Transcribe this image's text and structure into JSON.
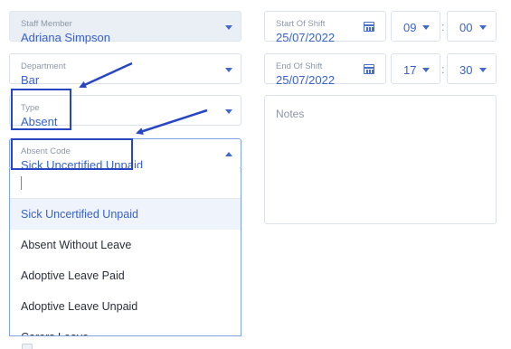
{
  "staff_member": {
    "label": "Staff Member",
    "value": "Adriana Simpson"
  },
  "department": {
    "label": "Department",
    "value": "Bar"
  },
  "type": {
    "label": "Type",
    "value": "Absent"
  },
  "absent_code": {
    "label": "Absent Code",
    "value": "Sick Uncertified Unpaid",
    "search_value": "",
    "options": [
      "Sick Uncertified Unpaid",
      "Absent Without Leave",
      "Adoptive Leave Paid",
      "Adoptive Leave Unpaid",
      "Carers Leave"
    ],
    "selected_index": 0
  },
  "start_of_shift": {
    "label": "Start Of Shift",
    "date": "25/07/2022",
    "hour": "09",
    "minute": "00"
  },
  "end_of_shift": {
    "label": "End Of Shift",
    "date": "25/07/2022",
    "hour": "17",
    "minute": "30"
  },
  "time_separator": ":",
  "notes": {
    "placeholder": "Notes"
  },
  "colors": {
    "accent": "#3a63c6",
    "highlight": "#2747c2",
    "field_filled": "#eaeef5",
    "selected_option": "#eef3fc"
  },
  "icons": [
    "calendar-icon",
    "chevron-down-icon",
    "chevron-up-icon",
    "annotation-arrow"
  ]
}
